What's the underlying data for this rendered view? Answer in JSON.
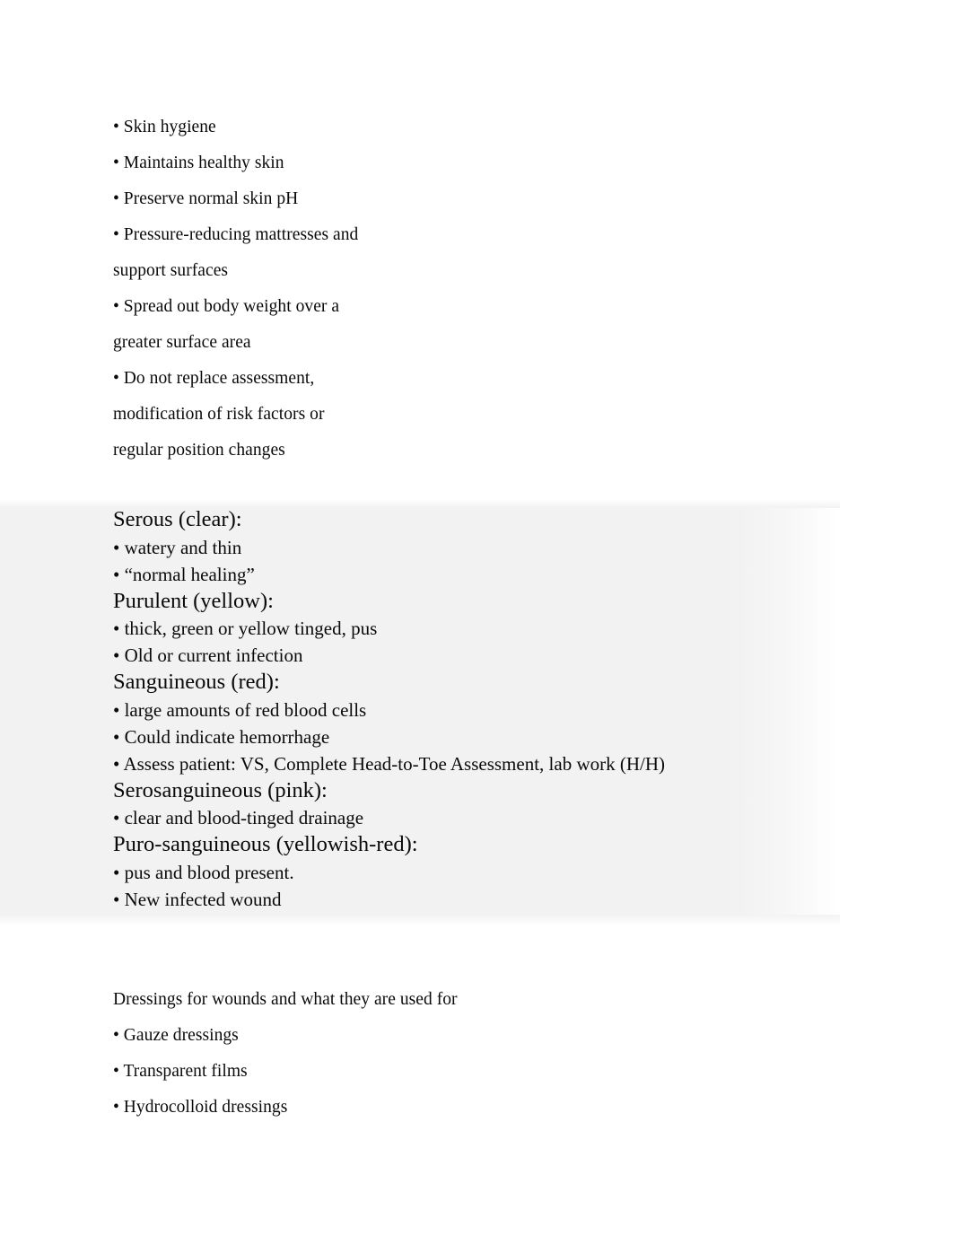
{
  "document": {
    "background_color": "#ffffff",
    "text_color": "#0a0a0a",
    "highlight_color": "#f2f2f2"
  },
  "top_list": {
    "name": "skin-care-bullet-list",
    "lines": [
      "• Skin hygiene",
      "• Maintains healthy skin",
      "• Preserve normal skin pH",
      "• Pressure-reducing mattresses and",
      "support surfaces",
      "• Spread out body weight over a",
      "greater surface area",
      "• Do not replace assessment,",
      "modification of risk factors or",
      "regular position changes"
    ]
  },
  "drainage_block": {
    "name": "wound-drainage-types-block",
    "entries": [
      {
        "heading": "Serous (clear):",
        "bullets": [
          "• watery and thin",
          "• “normal healing”"
        ]
      },
      {
        "heading": "Purulent (yellow):",
        "bullets": [
          "• thick, green or yellow tinged, pus",
          "• Old or current infection"
        ]
      },
      {
        "heading": "Sanguineous (red):",
        "bullets": [
          "• large amounts of red blood cells",
          "• Could indicate hemorrhage",
          "• Assess patient: VS, Complete Head-to-Toe Assessment, lab work (H/H)"
        ]
      },
      {
        "heading": "Serosanguineous (pink):",
        "bullets": [
          "• clear and blood-tinged drainage"
        ]
      },
      {
        "heading": "Puro-sanguineous (yellowish-red):",
        "bullets": [
          "• pus and blood present.",
          "• New infected wound"
        ]
      }
    ]
  },
  "bottom_list": {
    "name": "dressings-section",
    "heading": "Dressings for wounds and what they are used for",
    "lines": [
      "• Gauze dressings",
      "• Transparent films",
      "• Hydrocolloid dressings"
    ]
  }
}
